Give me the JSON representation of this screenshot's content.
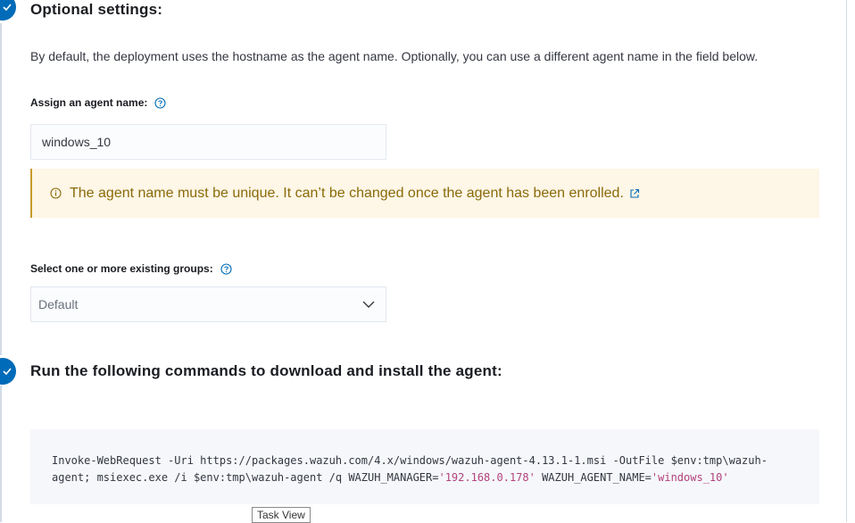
{
  "optional_settings": {
    "title": "Optional settings:",
    "description": "By default, the deployment uses the hostname as the agent name. Optionally, you can use a different agent name in the field below.",
    "agent_name_label": "Assign an agent name:",
    "agent_name_value": "windows_10",
    "warning_text": "The agent name must be unique. It can’t be changed once the agent has been enrolled.",
    "groups_label": "Select one or more existing groups:",
    "groups_selected": "Default"
  },
  "commands_step": {
    "title": "Run the following commands to download and install the agent:",
    "code_line1": "Invoke-WebRequest -Uri https://packages.wazuh.com/4.x/windows/wazuh-agent-4.13.1-1.msi -OutFile $env:tmp\\wazuh-",
    "code_line2_a": "agent; msiexec.exe /i $env:tmp\\wazuh-agent /q WAZUH_MANAGER=",
    "code_manager_value": "'192.168.0.178'",
    "code_line2_b": " WAZUH_AGENT_NAME=",
    "code_agent_name_value": "'windows_10'"
  },
  "tooltip": {
    "text": "Task View"
  },
  "colors": {
    "step_circle": "#006bb8",
    "warning_bg": "#fef6e6",
    "warning_text": "#8a6a0a",
    "code_string": "#b3427c"
  },
  "icons": {
    "step": "check-icon",
    "help": "question-circle-icon",
    "warning": "info-circle-icon",
    "external": "external-link-icon",
    "select": "chevron-down-icon"
  }
}
